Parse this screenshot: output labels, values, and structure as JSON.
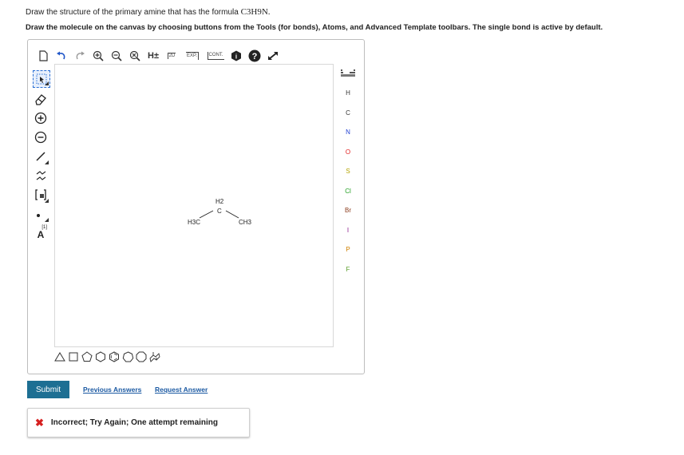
{
  "question": {
    "prompt": "Draw the structure of the primary amine that has the formula",
    "formula": "C3H9N.",
    "instructions": "Draw the molecule on the canvas by choosing buttons from the Tools (for bonds), Atoms, and Advanced Template toolbars. The single bond is active by default."
  },
  "top_toolbar": {
    "h_label": "H±",
    "label_2d": "2D",
    "exp_label": "EXP.",
    "cont_label": "CONT.",
    "info_label": "i",
    "help_label": "?"
  },
  "left_toolbar": {
    "charge_label": "A",
    "charge_sup": "[1]"
  },
  "atoms": [
    {
      "symbol": "H",
      "color": "#333333"
    },
    {
      "symbol": "C",
      "color": "#333333"
    },
    {
      "symbol": "N",
      "color": "#1f3fd1"
    },
    {
      "symbol": "O",
      "color": "#e01e1e"
    },
    {
      "symbol": "S",
      "color": "#b5a400"
    },
    {
      "symbol": "Cl",
      "color": "#22a022"
    },
    {
      "symbol": "Br",
      "color": "#8a3a1a"
    },
    {
      "symbol": "I",
      "color": "#8a1a8a"
    },
    {
      "symbol": "P",
      "color": "#d08000"
    },
    {
      "symbol": "F",
      "color": "#5a9e2a"
    }
  ],
  "molecule": {
    "left_group": "H3C",
    "center_group": "C",
    "center_h": "H2",
    "right_group": "CH3"
  },
  "actions": {
    "submit": "Submit",
    "previous": "Previous Answers",
    "request": "Request Answer"
  },
  "feedback": {
    "icon": "✖",
    "icon_color": "#d62020",
    "text": "Incorrect; Try Again; One attempt remaining"
  }
}
